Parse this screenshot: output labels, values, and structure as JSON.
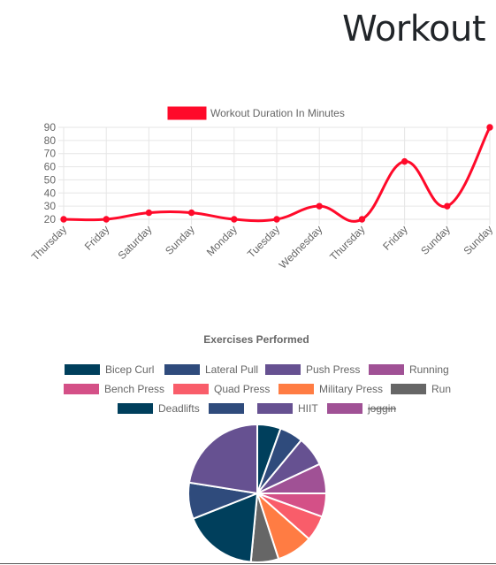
{
  "header": {
    "title": "Workout"
  },
  "chart_data": [
    {
      "type": "line",
      "categories": [
        "Thursday",
        "Friday",
        "Saturday",
        "Sunday",
        "Monday",
        "Tuesday",
        "Wednesday",
        "Thursday",
        "Friday",
        "Sunday",
        "Sunday"
      ],
      "series": [
        {
          "name": "Workout Duration In Minutes",
          "values": [
            20,
            20,
            25,
            25,
            20,
            20,
            30,
            20,
            64,
            30,
            90
          ],
          "color": "#ff0a2a"
        }
      ],
      "ylim": [
        20,
        90
      ],
      "yticks": [
        20,
        30,
        40,
        50,
        60,
        70,
        80,
        90
      ],
      "legend": "top",
      "grid": true
    },
    {
      "type": "pie",
      "title": "Exercises Performed",
      "legend": "top",
      "labels": [
        {
          "text": "Bicep Curl",
          "struck": false
        },
        {
          "text": "Lateral Pull",
          "struck": false
        },
        {
          "text": "Push Press",
          "struck": false
        },
        {
          "text": "Running",
          "struck": false
        },
        {
          "text": "Bench Press",
          "struck": false
        },
        {
          "text": "Quad Press",
          "struck": false
        },
        {
          "text": "Military Press",
          "struck": false
        },
        {
          "text": "Run",
          "struck": false
        },
        {
          "text": "Deadlifts",
          "struck": false
        },
        {
          "text": "",
          "struck": false
        },
        {
          "text": "HIIT",
          "struck": false
        },
        {
          "text": "joggin",
          "struck": true
        }
      ],
      "colors": [
        "#003f5c",
        "#2f4b7c",
        "#665191",
        "#a05195",
        "#d45087",
        "#f95d6a",
        "#ff7c43",
        "#666666",
        "#003f5c",
        "#2f4b7c",
        "#665191",
        "#a05195"
      ],
      "slices": [
        {
          "label": "Bicep Curl",
          "value": 5.5
        },
        {
          "label": "Lateral Pull",
          "value": 5.5
        },
        {
          "label": "Push Press",
          "value": 7
        },
        {
          "label": "Running",
          "value": 7
        },
        {
          "label": "Bench Press",
          "value": 5.5
        },
        {
          "label": "Quad Press",
          "value": 6
        },
        {
          "label": "Military Press",
          "value": 8.5
        },
        {
          "label": "Run",
          "value": 6.5
        },
        {
          "label": "Deadlifts",
          "value": 17.5
        },
        {
          "label": "",
          "value": 8.5
        },
        {
          "label": "HIIT",
          "value": 22.5
        }
      ]
    }
  ]
}
